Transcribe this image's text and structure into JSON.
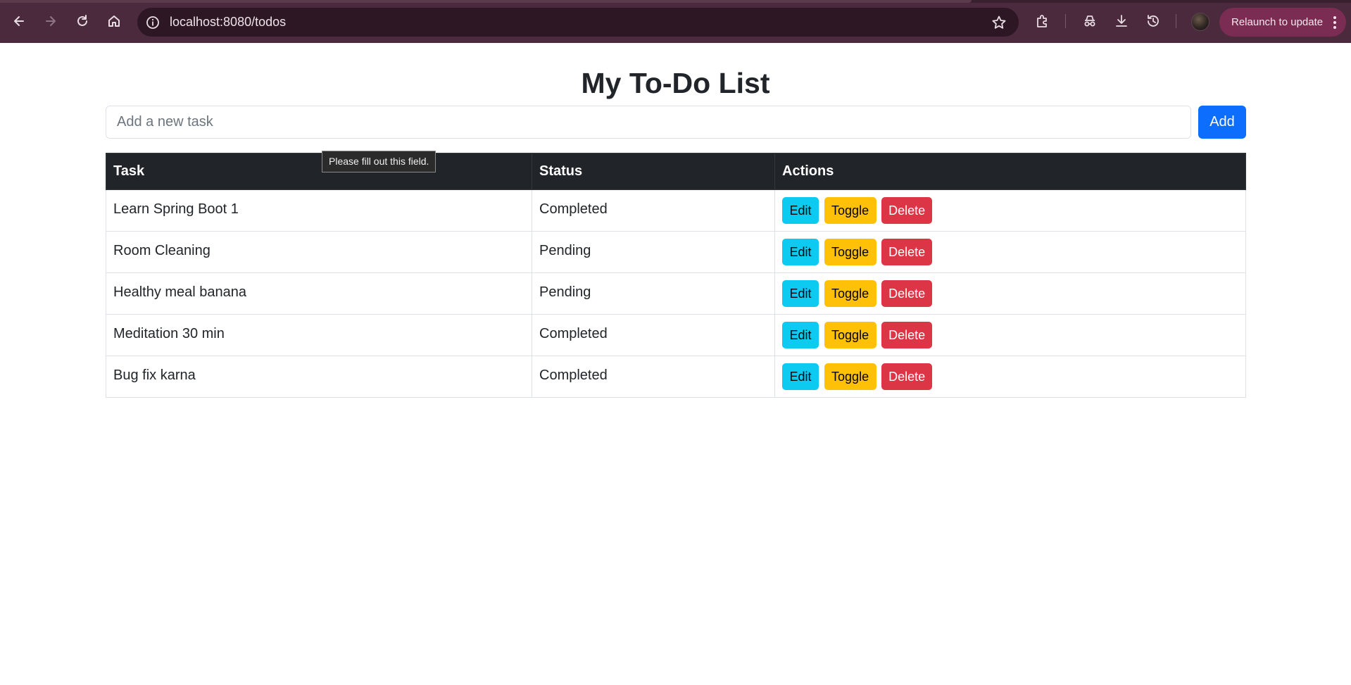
{
  "browser": {
    "url": "localhost:8080/todos",
    "relaunch_label": "Relaunch to update",
    "icons": {
      "back": "back-arrow-icon",
      "forward": "forward-arrow-icon",
      "reload": "reload-icon",
      "home": "home-icon",
      "site_info": "site-info-icon",
      "bookmark": "star-icon",
      "extensions": "puzzle-icon",
      "incognito": "incognito-icon",
      "downloads": "download-icon",
      "history": "history-icon",
      "menu": "kebab-menu-icon"
    }
  },
  "page": {
    "title": "My To-Do List",
    "input_placeholder": "Add a new task",
    "input_value": "",
    "add_label": "Add",
    "validation_tooltip": "Please fill out this field."
  },
  "table": {
    "headers": [
      "Task",
      "Status",
      "Actions"
    ],
    "rows": [
      {
        "task": "Learn Spring Boot 1",
        "status": "Completed"
      },
      {
        "task": "Room Cleaning",
        "status": "Pending"
      },
      {
        "task": "Healthy meal banana",
        "status": "Pending"
      },
      {
        "task": "Meditation 30 min",
        "status": "Completed"
      },
      {
        "task": "Bug fix karna",
        "status": "Completed"
      }
    ],
    "actions": {
      "edit_label": "Edit",
      "toggle_label": "Toggle",
      "delete_label": "Delete"
    }
  },
  "colors": {
    "chrome_bg": "#4a2a3c",
    "omnibox_bg": "#2e1724",
    "relaunch_bg": "#7b2c52",
    "primary": "#0d6efd",
    "info": "#0dcaf0",
    "warning": "#ffc107",
    "danger": "#dc3545",
    "table_header": "#212529"
  }
}
